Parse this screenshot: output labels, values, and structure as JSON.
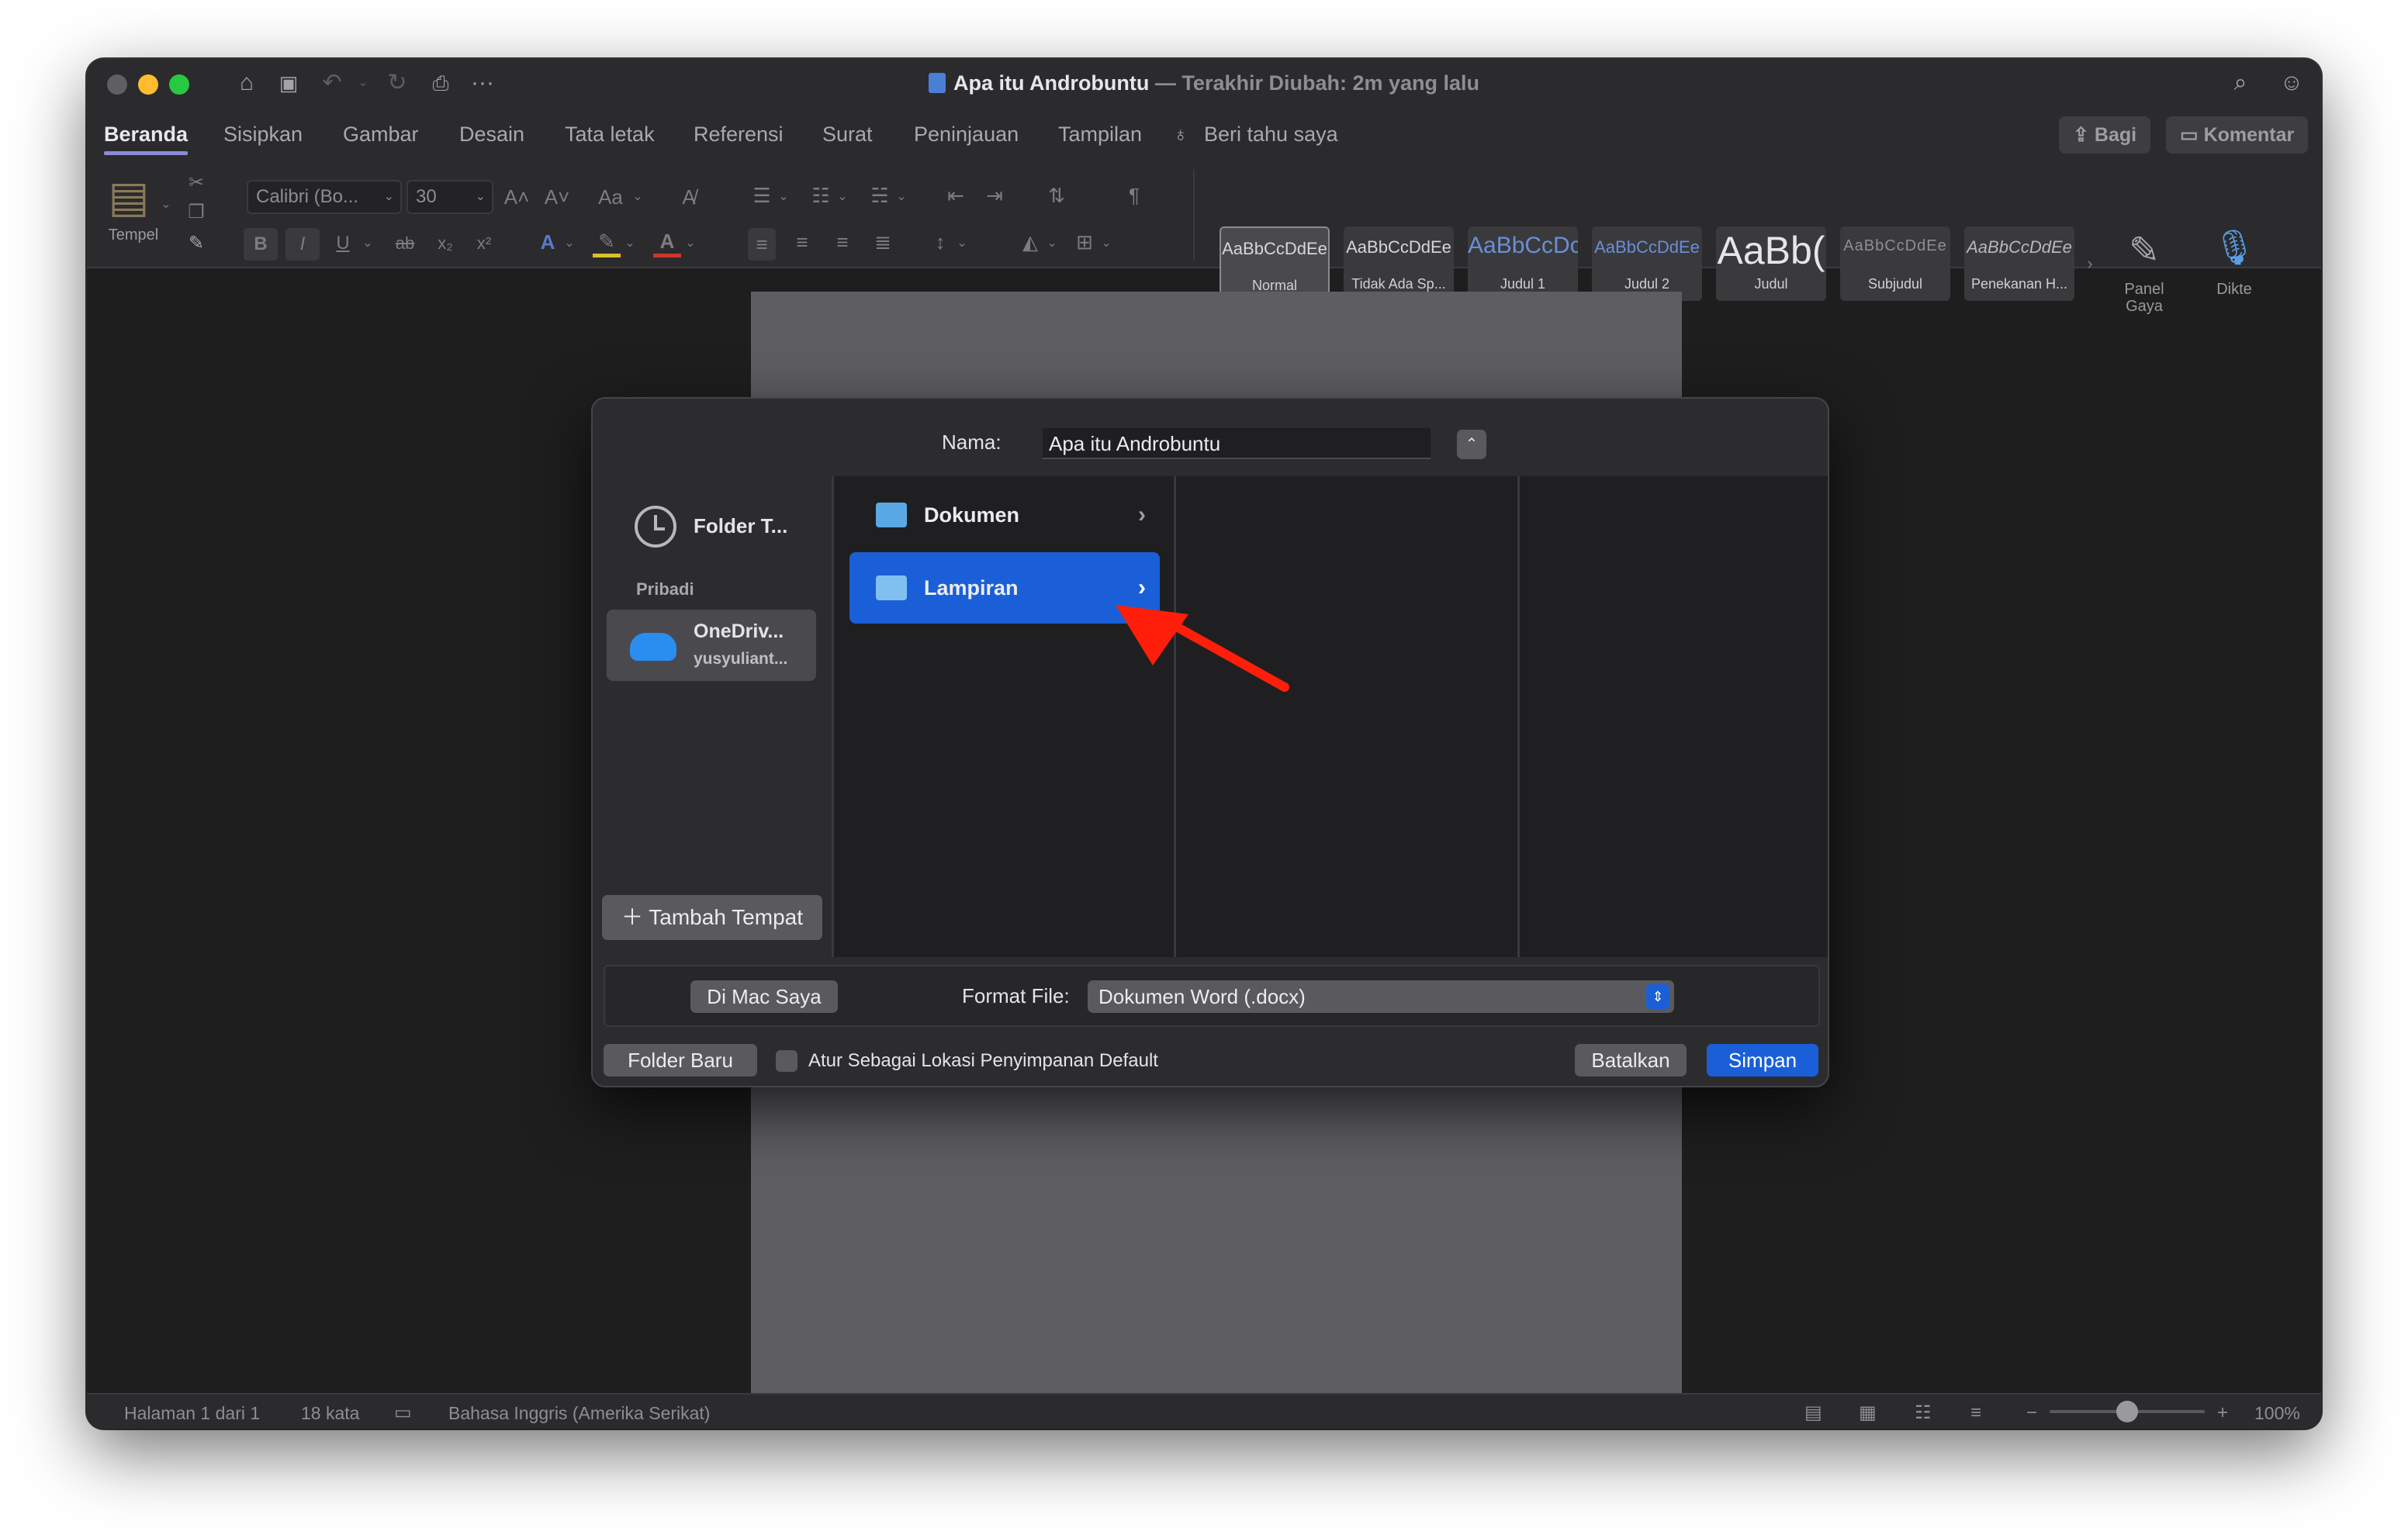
{
  "window": {
    "title": "Apa itu Androbuntu",
    "title_separator": "—",
    "subtitle": "Terakhir Diubah: 2m yang lalu",
    "qa_more": "···"
  },
  "tabs": [
    "Beranda",
    "Sisipkan",
    "Gambar",
    "Desain",
    "Tata letak",
    "Referensi",
    "Surat",
    "Peninjauan",
    "Tampilan"
  ],
  "tell_me": "Beri tahu saya",
  "header_buttons": {
    "share": "Bagi",
    "comments": "Komentar"
  },
  "ribbon": {
    "paste_label": "Tempel",
    "font_name": "Calibri (Bo...",
    "font_size": "30",
    "grow": "A˄",
    "shrink": "A˅",
    "change_case": "Aa",
    "bold": "B",
    "italic": "I",
    "underline": "U",
    "strike": "ab",
    "subscript": "x₂",
    "superscript": "x²",
    "pilcrow": "¶",
    "styles": [
      {
        "preview": "AaBbCcDdEe",
        "name": "Normal"
      },
      {
        "preview": "AaBbCcDdEe",
        "name": "Tidak Ada Sp..."
      },
      {
        "preview": "AaBbCcDc",
        "name": "Judul 1"
      },
      {
        "preview": "AaBbCcDdEe",
        "name": "Judul 2"
      },
      {
        "preview": "AaBb(",
        "name": "Judul"
      },
      {
        "preview": "AaBbCcDdEe",
        "name": "Subjudul"
      },
      {
        "preview": "AaBbCcDdEe",
        "name": "Penekanan H..."
      }
    ],
    "styles_pane": "Panel Gaya",
    "dictate": "Dikte"
  },
  "status": {
    "page": "Halaman 1 dari 1",
    "words": "18 kata",
    "language": "Bahasa Inggris (Amerika Serikat)",
    "zoom": "100%",
    "zoom_level_fraction": 0.5
  },
  "dialog": {
    "name_label": "Nama:",
    "name_value": "Apa itu Androbuntu",
    "sidebar": {
      "recent": "Folder T...",
      "section": "Pribadi",
      "onedrive_title": "OneDriv...",
      "onedrive_sub": "yusyuliant..."
    },
    "folders": [
      {
        "name": "Dokumen",
        "selected": false
      },
      {
        "name": "Lampiran",
        "selected": true
      }
    ],
    "add_place": "Tambah Tempat",
    "on_my_mac": "Di Mac Saya",
    "format_label": "Format File:",
    "format_value": "Dokumen Word (.docx)",
    "new_folder": "Folder Baru",
    "default_location": "Atur Sebagai Lokasi Penyimpanan Default",
    "cancel": "Batalkan",
    "save": "Simpan"
  },
  "colors": {
    "accent": "#1b5fd8",
    "folder": "#5aa9e6",
    "annotation_arrow": "#ff1e0a"
  }
}
